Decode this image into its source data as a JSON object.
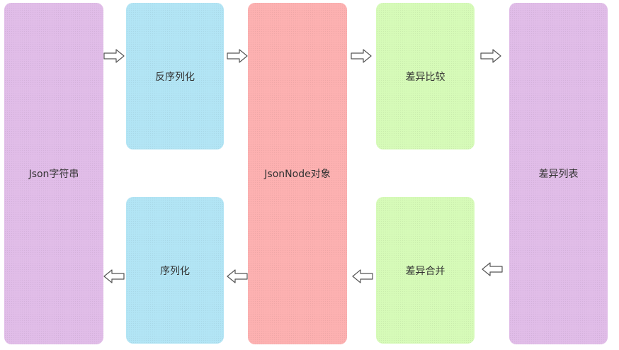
{
  "nodes": {
    "json_string": "Json字符串",
    "deserialize": "反序列化",
    "jsonnode": "JsonNode对象",
    "diff_compare": "差异比较",
    "diff_list": "差异列表",
    "serialize": "序列化",
    "diff_merge": "差异合并"
  },
  "colors": {
    "purple": "#e1bde8",
    "blue": "#b2e5f5",
    "red": "#fdb1b1",
    "green": "#d6fbb8",
    "arrow_stroke": "#555555"
  },
  "arrows": [
    {
      "from": "json_string",
      "to": "deserialize",
      "direction": "right"
    },
    {
      "from": "deserialize",
      "to": "jsonnode",
      "direction": "right"
    },
    {
      "from": "jsonnode",
      "to": "diff_compare",
      "direction": "right"
    },
    {
      "from": "diff_compare",
      "to": "diff_list",
      "direction": "right"
    },
    {
      "from": "diff_list",
      "to": "diff_merge",
      "direction": "left"
    },
    {
      "from": "diff_merge",
      "to": "jsonnode",
      "direction": "left"
    },
    {
      "from": "jsonnode",
      "to": "serialize",
      "direction": "left"
    },
    {
      "from": "serialize",
      "to": "json_string",
      "direction": "left"
    }
  ]
}
